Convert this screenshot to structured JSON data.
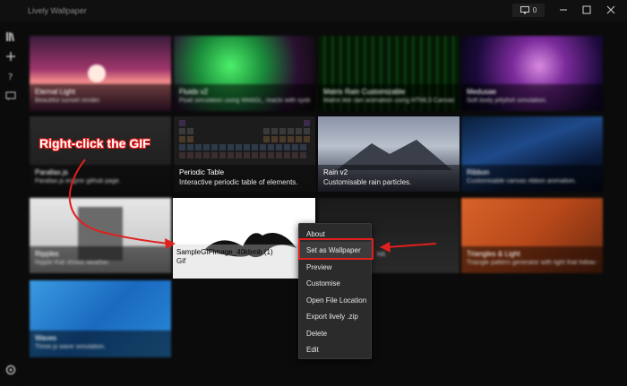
{
  "app": {
    "title": "Lively Wallpaper",
    "screen_count": "0"
  },
  "tiles": [
    {
      "title": "Eternal Light",
      "subtitle": "Beautiful sunset render."
    },
    {
      "title": "Fluids v2",
      "subtitle": "Fluid simulation using WebGL, reacts with system audio & cursor."
    },
    {
      "title": "Matrix Rain Customizable",
      "subtitle": "Matrix like rain animation using HTML5 Canvas."
    },
    {
      "title": "Medusae",
      "subtitle": "Soft body jellyfish simulation."
    },
    {
      "title": "Parallax.js",
      "subtitle": "Parallax.js engine github page."
    },
    {
      "title": "Periodic Table",
      "subtitle": "Interactive periodic table of elements."
    },
    {
      "title": "Rain v2",
      "subtitle": "Customisable rain particles."
    },
    {
      "title": "Ribbon",
      "subtitle": "Customisable canvas ribbon animation."
    },
    {
      "title": "Ripples",
      "subtitle": "Ripple that shows weather."
    },
    {
      "title": "SampleGIFImage_40kbmb (1)",
      "subtitle": "Gif"
    },
    {
      "title": "",
      "subtitle": "hill."
    },
    {
      "title": "Triangles & Light",
      "subtitle": "Triangle pattern generator with light that follow cursor."
    },
    {
      "title": "Waves",
      "subtitle": "Three.js wave simulation."
    }
  ],
  "context_menu": [
    "About",
    "Set as Wallpaper",
    "Preview",
    "Customise",
    "Open File Location",
    "Export lively .zip",
    "Delete",
    "Edit"
  ],
  "annotation": {
    "text": "Right-click the GIF",
    "color": "#e0201e"
  }
}
